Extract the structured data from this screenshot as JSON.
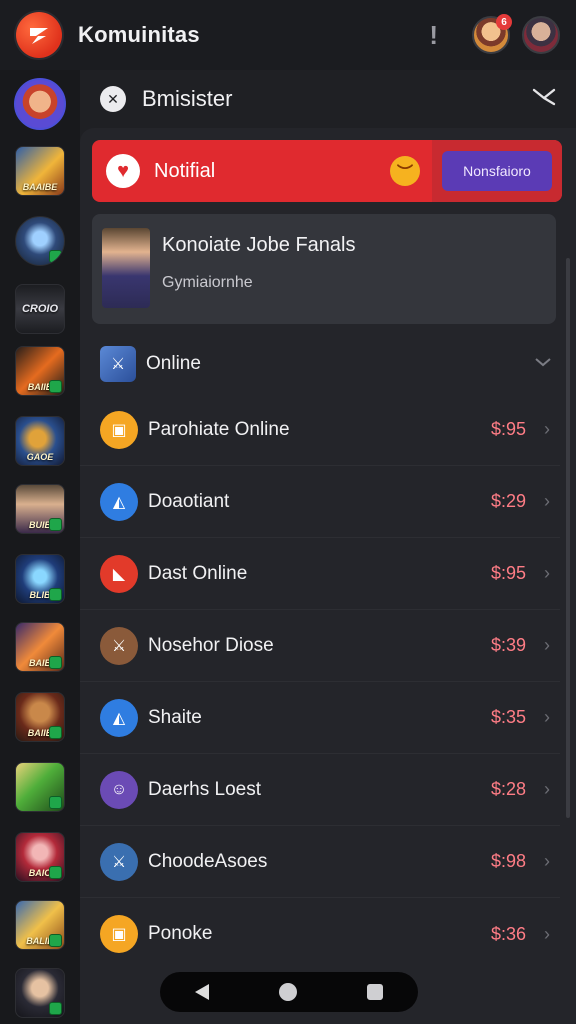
{
  "app": {
    "title": "Komuinitas",
    "alert_icon": "alert-exclamation-icon",
    "badge_count": "6"
  },
  "panel": {
    "title": "Bmisister",
    "close_icon": "collapse-icon"
  },
  "notification": {
    "label": "Notifial",
    "action_label": "Nonsfaioro",
    "accent": "#e02a2f",
    "button_color": "#5b3bb5"
  },
  "feature": {
    "title": "Konoiate Jobe Fanals",
    "subtitle": "Gymiaiornhe"
  },
  "section": {
    "label": "Online"
  },
  "rail_games": [
    {
      "label": "BAAIBE"
    },
    {
      "label": ""
    },
    {
      "label": "CROIO"
    },
    {
      "label": "BAIIB"
    },
    {
      "label": "GAOE"
    },
    {
      "label": "BUIB"
    },
    {
      "label": "BLIB"
    },
    {
      "label": "BAIB"
    },
    {
      "label": "BAIIB"
    },
    {
      "label": ""
    },
    {
      "label": "BAIO"
    },
    {
      "label": "BALIB"
    },
    {
      "label": ""
    }
  ],
  "rows": [
    {
      "label": "Parohiate Online",
      "price": "$:95",
      "icon_color": "#f5a623"
    },
    {
      "label": "Doaotiant",
      "price": "$:29",
      "icon_color": "#2f7de1"
    },
    {
      "label": "Dast Online",
      "price": "$:95",
      "icon_color": "#e23a2a"
    },
    {
      "label": "Nosehor Diose",
      "price": "$:39",
      "icon_color": "#8a5a3a"
    },
    {
      "label": "Shaite",
      "price": "$:35",
      "icon_color": "#2f7de1"
    },
    {
      "label": "Daerhs Loest",
      "price": "$:28",
      "icon_color": "#6b4bb5"
    },
    {
      "label": "ChoodeAsoes",
      "price": "$:98",
      "icon_color": "#3a6fb0"
    },
    {
      "label": "Ponoke",
      "price": "$:36",
      "icon_color": "#f5a623"
    }
  ]
}
